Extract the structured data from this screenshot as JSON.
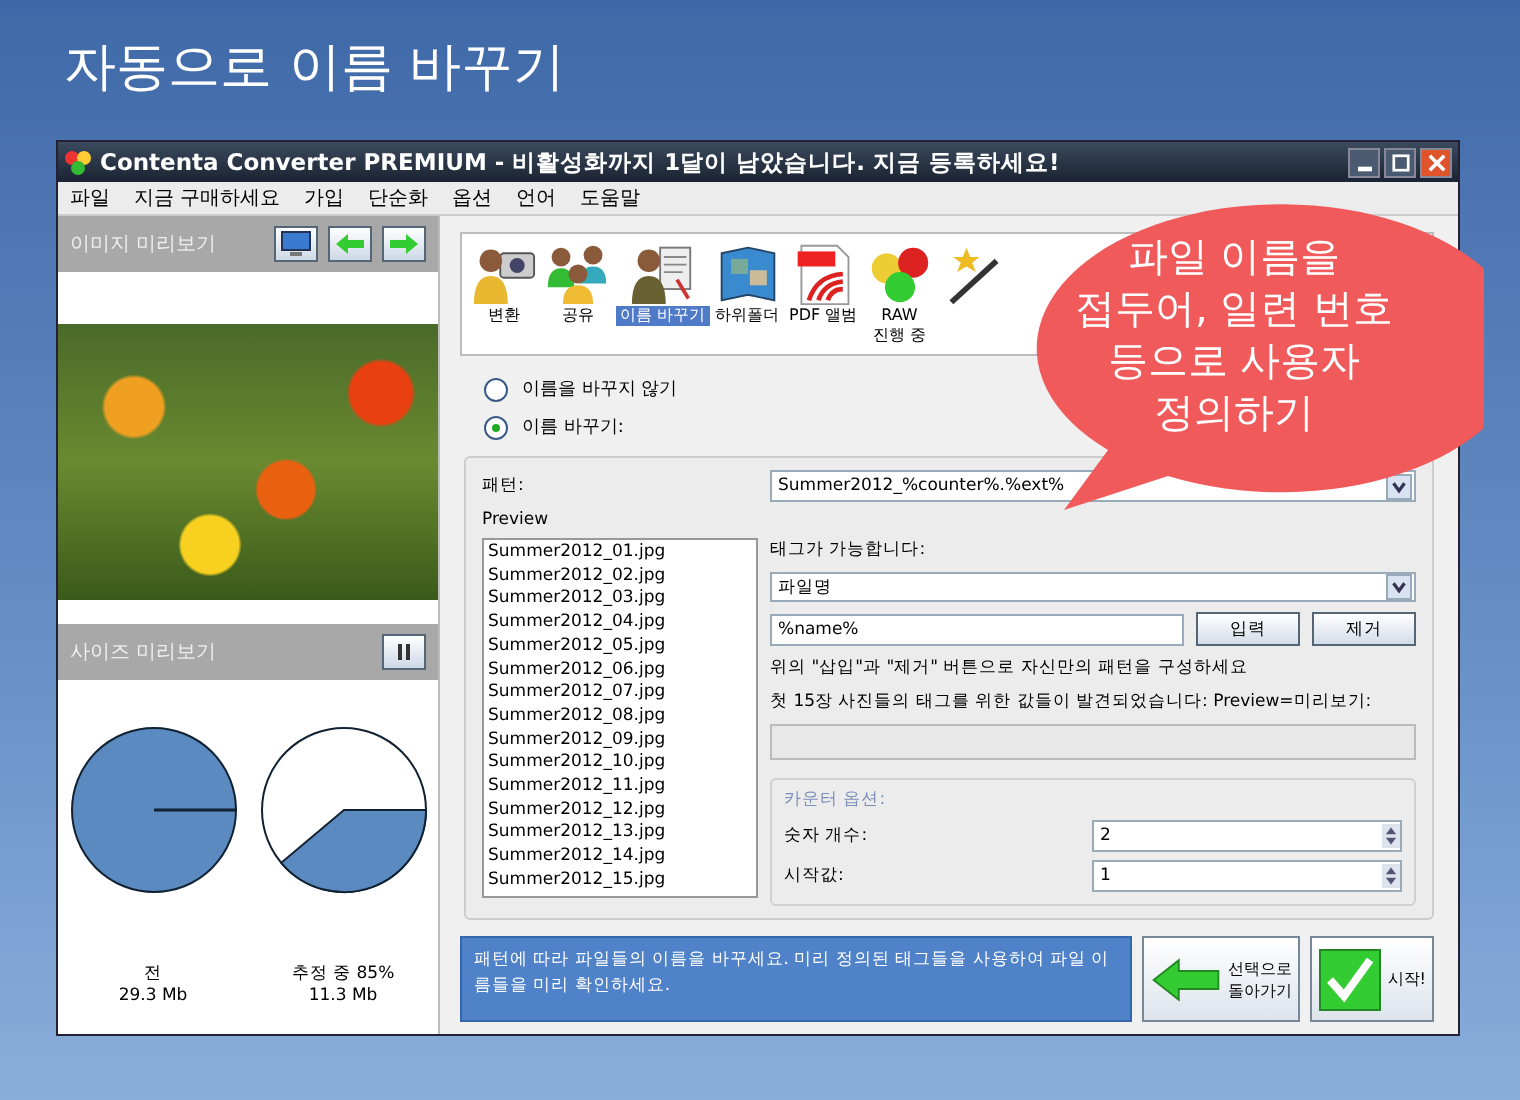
{
  "heading": "자동으로 이름 바꾸기",
  "window": {
    "title": "Contenta Converter PREMIUM - 비활성화까지 1달이 남았습니다. 지금 등록하세요!"
  },
  "menu": [
    "파일",
    "지금 구매하세요",
    "가입",
    "단순화",
    "옵션",
    "언어",
    "도움말"
  ],
  "image_preview": {
    "title": "이미지 미리보기"
  },
  "size_preview": {
    "title": "사이즈 미리보기",
    "before": {
      "label": "전",
      "size": "29.3 Mb"
    },
    "after": {
      "label": "추정 중 85%",
      "size": "11.3 Mb"
    }
  },
  "toolbar": [
    {
      "kind": "convert",
      "label": "변환",
      "selected": false
    },
    {
      "kind": "share",
      "label": "공유",
      "selected": false
    },
    {
      "kind": "rename",
      "label": "이름 바꾸기",
      "selected": true
    },
    {
      "kind": "subfolder",
      "label": "하위폴더",
      "selected": false
    },
    {
      "kind": "pdf",
      "label": "PDF 앨범",
      "selected": false
    },
    {
      "kind": "raw",
      "label": "RAW\n진행 중",
      "selected": false
    },
    {
      "kind": "effects"
    }
  ],
  "rename_options": [
    {
      "label": "이름을 바꾸지 않기",
      "selected": false
    },
    {
      "label": "이름 바꾸기:",
      "selected": true
    }
  ],
  "pattern": {
    "label": "패턴:",
    "value": "Summer2012_%counter%.%ext%"
  },
  "preview": {
    "label": "Preview",
    "files": [
      "Summer2012_01.jpg",
      "Summer2012_02.jpg",
      "Summer2012_03.jpg",
      "Summer2012_04.jpg",
      "Summer2012_05.jpg",
      "Summer2012_06.jpg",
      "Summer2012_07.jpg",
      "Summer2012_08.jpg",
      "Summer2012_09.jpg",
      "Summer2012_10.jpg",
      "Summer2012_11.jpg",
      "Summer2012_12.jpg",
      "Summer2012_13.jpg",
      "Summer2012_14.jpg",
      "Summer2012_15.jpg"
    ]
  },
  "tags": {
    "label": "태그가 가능합니다:",
    "selected_tag": "파일명",
    "tag_value": "%name%",
    "buttons": [
      "입력",
      "제거"
    ],
    "hint": "위의 \"삽입\"과 \"제거\" 버튼으로 자신만의 패턴을 구성하세요",
    "found_label": "첫 15장 사진들의 태그를 위한 값들이 발견되었습니다: Preview=미리보기:"
  },
  "counter": {
    "title": "카운터 옵션:",
    "fields": [
      {
        "label": "숫자 개수:",
        "value": "2"
      },
      {
        "label": "시작값:",
        "value": "1"
      }
    ]
  },
  "info": "패턴에 따라 파일들의 이름을 바꾸세요. 미리 정의된 태그들을 사용하여 파일 이름들을 미리 확인하세요.",
  "buttons": [
    {
      "kind": "back",
      "label": "선택으로\n돌아가기"
    },
    {
      "kind": "start",
      "label": "시작!"
    }
  ],
  "callout": "파일 이름을\n접두어, 일련 번호\n등으로 사용자\n정의하기"
}
